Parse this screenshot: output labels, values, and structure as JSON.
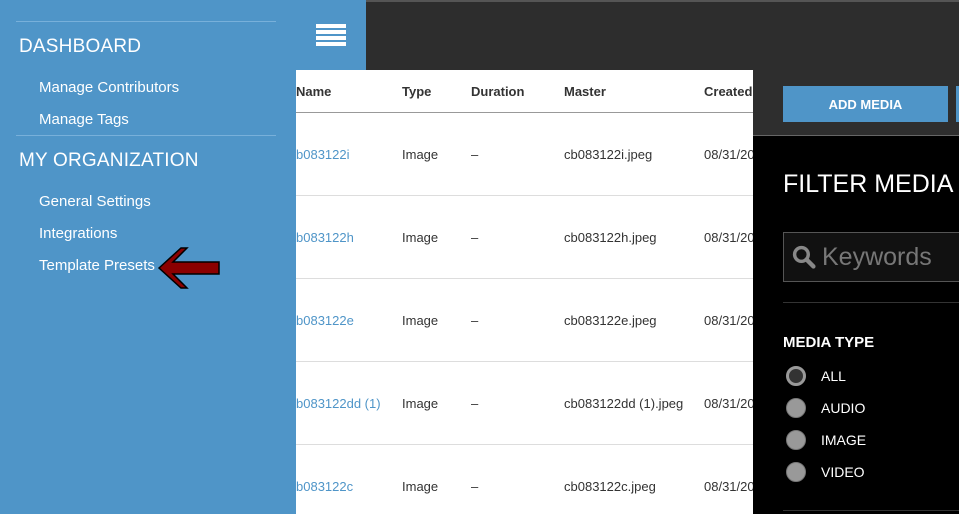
{
  "sidebar": {
    "sections": [
      {
        "title": "DASHBOARD",
        "items": [
          "Manage Contributors",
          "Manage Tags"
        ]
      },
      {
        "title": "MY ORGANIZATION",
        "items": [
          "General Settings",
          "Integrations",
          "Template Presets"
        ]
      }
    ]
  },
  "table": {
    "headers": [
      "Name",
      "Type",
      "Duration",
      "Master",
      "Created"
    ],
    "rows": [
      {
        "name": "b083122i",
        "type": "Image",
        "duration": "–",
        "master": "cb083122i.jpeg",
        "created": "08/31/20"
      },
      {
        "name": "b083122h",
        "type": "Image",
        "duration": "–",
        "master": "cb083122h.jpeg",
        "created": "08/31/20"
      },
      {
        "name": "b083122e",
        "type": "Image",
        "duration": "–",
        "master": "cb083122e.jpeg",
        "created": "08/31/20"
      },
      {
        "name": "b083122dd (1)",
        "type": "Image",
        "duration": "–",
        "master": "cb083122dd (1).jpeg",
        "created": "08/31/20"
      },
      {
        "name": "b083122c",
        "type": "Image",
        "duration": "–",
        "master": "cb083122c.jpeg",
        "created": "08/31/20"
      }
    ]
  },
  "panel": {
    "add_media": "ADD MEDIA",
    "filter_title": "FILTER MEDIA",
    "search_placeholder": "Keywords",
    "media_type_label": "MEDIA TYPE",
    "options": [
      "ALL",
      "AUDIO",
      "IMAGE",
      "VIDEO"
    ],
    "selected": "ALL"
  },
  "colors": {
    "accent": "#4f95c8",
    "arrow": "#8b0000"
  }
}
